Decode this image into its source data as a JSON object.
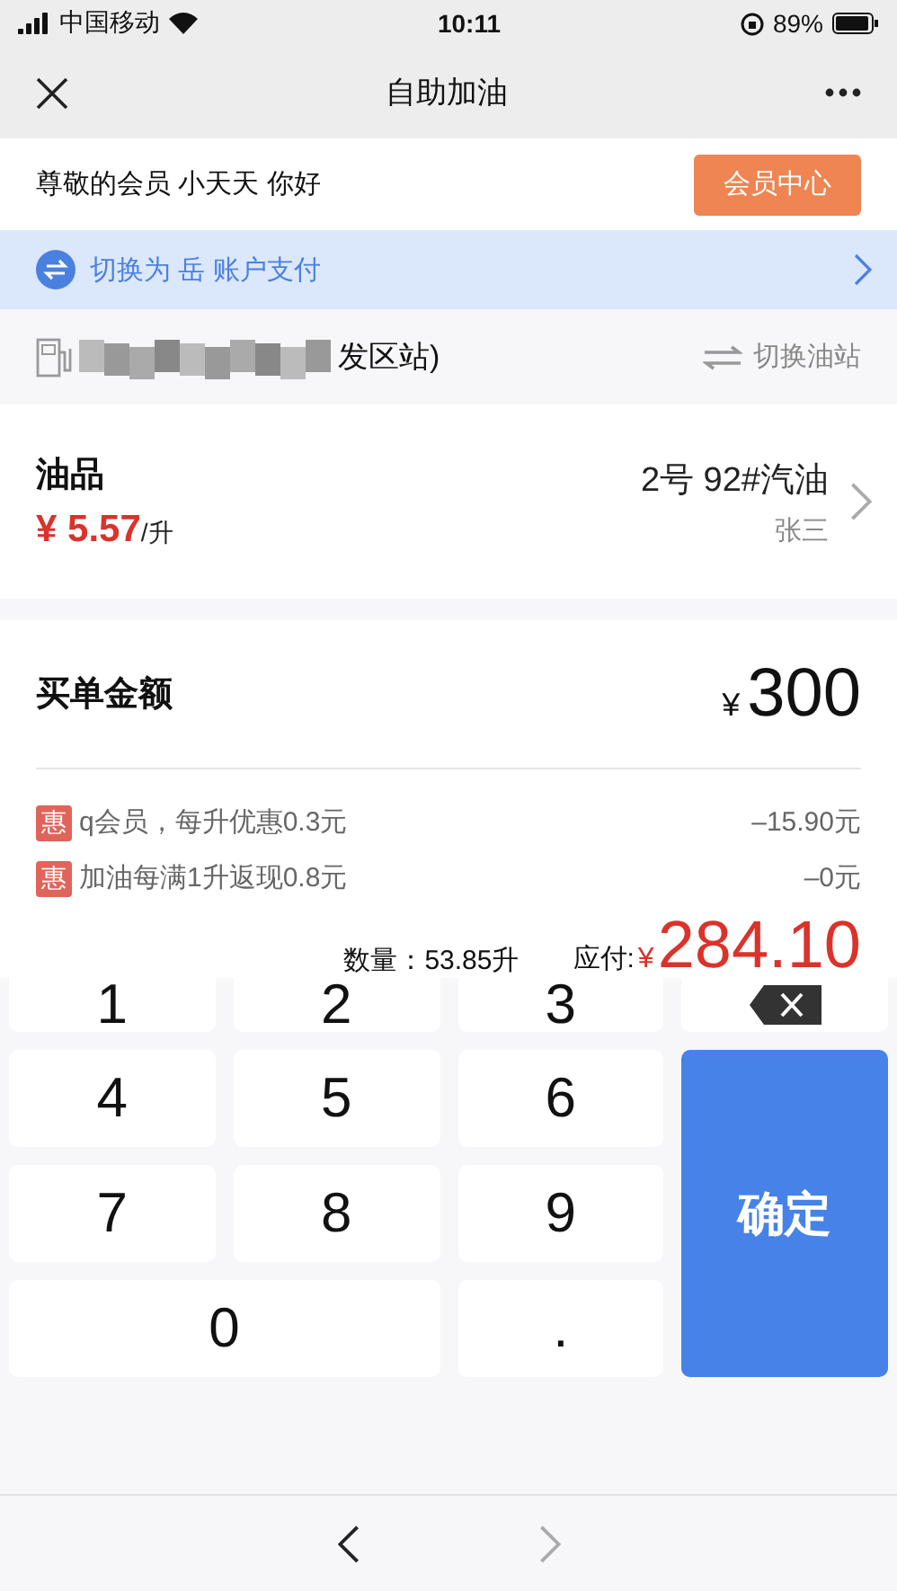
{
  "status_bar": {
    "carrier": "中国移动",
    "time": "10:11",
    "battery": "89%"
  },
  "nav": {
    "title": "自助加油"
  },
  "member": {
    "greeting": "尊敬的会员 小天天 你好",
    "button": "会员中心"
  },
  "switch_account": {
    "label": "切换为 岳 账户支付"
  },
  "station": {
    "name": "发区站)",
    "switch": "切换油站"
  },
  "fuel": {
    "label": "油品",
    "price_symbol": "¥",
    "price": "5.57",
    "unit": "/升",
    "product": "2号 92#汽油",
    "attendant": "张三"
  },
  "amount": {
    "label": "买单金额",
    "currency": "¥",
    "value": "300"
  },
  "discounts": [
    {
      "badge": "惠",
      "text": "q会员，每升优惠0.3元",
      "value": "–15.90元"
    },
    {
      "badge": "惠",
      "text": "加油每满1升返现0.8元",
      "value": "–0元"
    }
  ],
  "summary": {
    "quantity": "数量：53.85升",
    "payable_label": "应付:",
    "currency": "¥",
    "payable": "284.10"
  },
  "keypad": [
    {
      "kind": "digit",
      "label": "1"
    },
    {
      "kind": "digit",
      "label": "2"
    },
    {
      "kind": "digit",
      "label": "3"
    },
    {
      "kind": "backspace"
    },
    {
      "kind": "digit",
      "label": "4"
    },
    {
      "kind": "digit",
      "label": "5"
    },
    {
      "kind": "digit",
      "label": "6"
    },
    {
      "kind": "digit",
      "label": "7"
    },
    {
      "kind": "digit",
      "label": "8"
    },
    {
      "kind": "digit",
      "label": "9"
    },
    {
      "kind": "zero",
      "label": "0"
    },
    {
      "kind": "digit",
      "label": "."
    },
    {
      "kind": "confirm",
      "label": "确定"
    }
  ],
  "browser_nav": {
    "back_disabled": false,
    "forward_disabled": true
  }
}
